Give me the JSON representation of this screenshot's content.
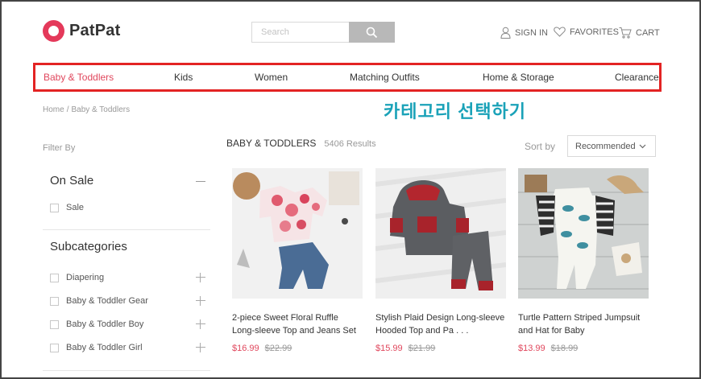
{
  "header": {
    "logo_text": "PatPat",
    "search_placeholder": "Search",
    "sign_in": "SIGN IN",
    "favorites": "FAVORITES",
    "cart": "CART"
  },
  "nav": {
    "items": [
      "Baby & Toddlers",
      "Kids",
      "Women",
      "Matching Outfits",
      "Home & Storage",
      "Clearance"
    ],
    "active_index": 0,
    "highlight_color": "#e32323"
  },
  "breadcrumb": {
    "home": "Home",
    "separator": "/",
    "current": "Baby & Toddlers"
  },
  "annotation": "카테고리 선택하기",
  "sidebar": {
    "filter_by": "Filter By",
    "on_sale": {
      "title": "On Sale",
      "options": [
        "Sale"
      ]
    },
    "subcategories": {
      "title": "Subcategories",
      "options": [
        "Diapering",
        "Baby & Toddler Gear",
        "Baby & Toddler Boy",
        "Baby & Toddler Girl"
      ]
    }
  },
  "results": {
    "title": "BABY & TODDLERS",
    "count": "5406 Results",
    "sort_label": "Sort by",
    "sort_value": "Recommended"
  },
  "products": [
    {
      "name": "2-piece Sweet Floral Ruffle Long-sleeve Top and Jeans Set",
      "price": "$16.99",
      "old_price": "$22.99"
    },
    {
      "name": "Stylish Plaid Design Long-sleeve Hooded Top and Pa . . .",
      "price": "$15.99",
      "old_price": "$21.99"
    },
    {
      "name": "Turtle Pattern Striped Jumpsuit and Hat for Baby",
      "price": "$13.99",
      "old_price": "$18.99"
    }
  ],
  "colors": {
    "brand": "#e4395a",
    "price": "#e0475d",
    "annotation": "#1aa2b8"
  }
}
